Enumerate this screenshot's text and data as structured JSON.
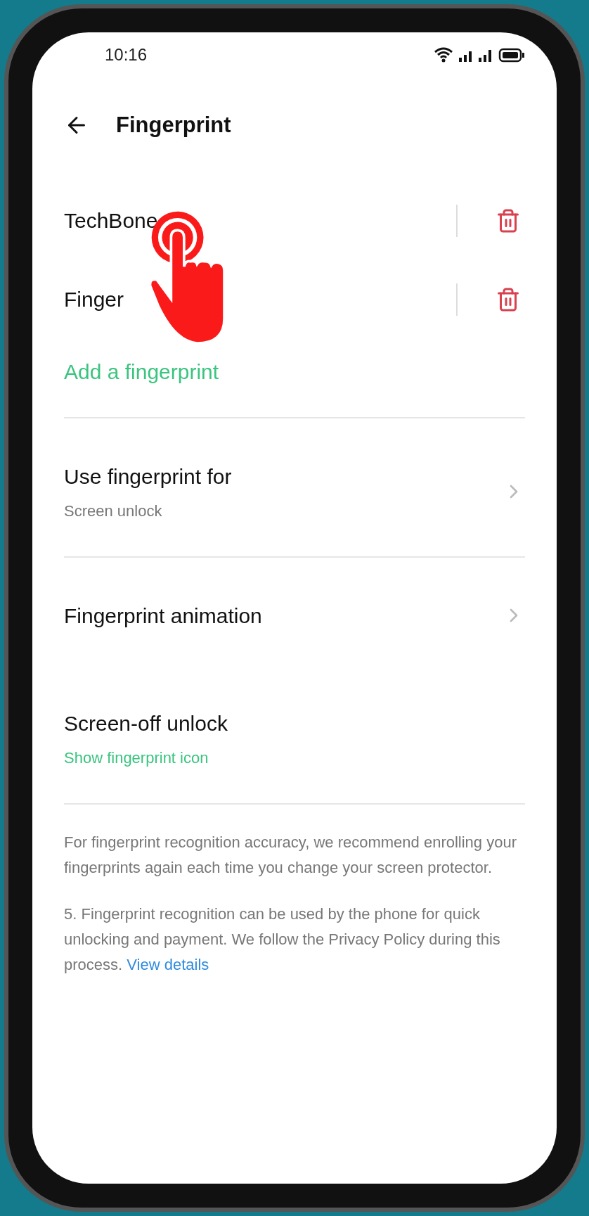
{
  "status_bar": {
    "time": "10:16"
  },
  "header": {
    "title": "Fingerprint"
  },
  "fingerprints": [
    {
      "name": "TechBone"
    },
    {
      "name": "Finger"
    }
  ],
  "add_link": "Add a fingerprint",
  "settings": [
    {
      "kind": "nav",
      "title": "Use fingerprint for",
      "subtitle": "Screen unlock",
      "divider_after": true
    },
    {
      "kind": "nav",
      "title": "Fingerprint animation",
      "divider_after": false
    },
    {
      "kind": "plain",
      "title": "Screen-off unlock",
      "accent_subtitle": "Show fingerprint icon",
      "divider_after": true
    }
  ],
  "notes": [
    {
      "text": "For fingerprint recognition accuracy, we recommend enrolling your fingerprints again each time you change your screen protector."
    },
    {
      "text": "5. Fingerprint recognition can be used by the phone for quick unlocking and payment. We follow the Privacy Policy during this process.",
      "link": "View details"
    }
  ]
}
